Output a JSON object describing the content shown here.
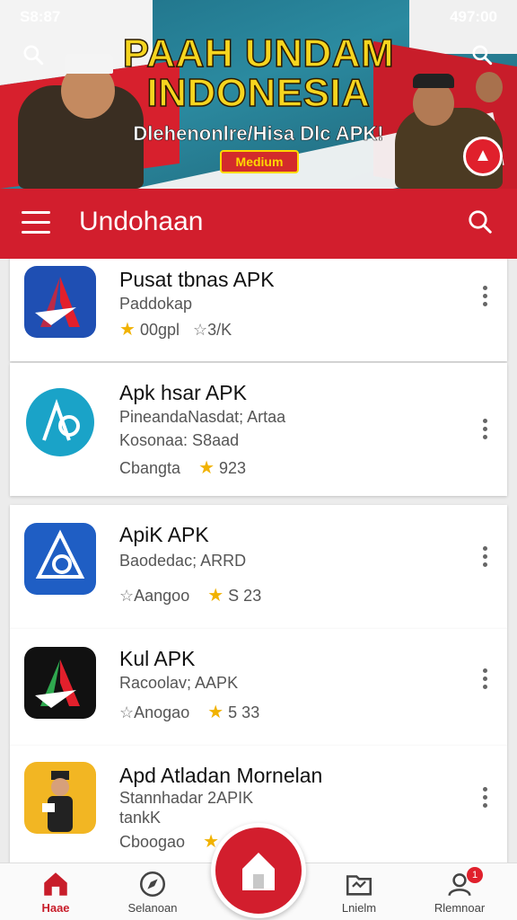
{
  "status_bar": {
    "left": "S8:87",
    "right": "497:00"
  },
  "banner": {
    "title_line1": "PAAH UNDAM",
    "title_line2": "INDONESIA",
    "subtitle": "Dlehenonlre/Hisa Dlc APK!",
    "badge": "Medium"
  },
  "appbar": {
    "title": "Undohaan"
  },
  "apps": [
    {
      "name": "Pusat tbnas APK",
      "line1": "Paddokap",
      "meta_left": "00gpl",
      "rating": "3/K"
    },
    {
      "name": "Apk hsar APK",
      "line1": "PineandaNasdat; Artaa",
      "line2": "Kosonaa: S8aad",
      "meta_left": "Cbangta",
      "rating": "923"
    },
    {
      "name": "ApiK APK",
      "line1": "Baodedac; ARRD",
      "meta_left": "Aangoo",
      "rating": "S 23"
    },
    {
      "name": "Kul APK",
      "line1": "Racoolav; AAPK",
      "meta_left": "Anogao",
      "rating": "5 33"
    },
    {
      "name": "Apd Atladan Mornelan",
      "line1": "Stannhadar 2APIK",
      "line2": "tankK",
      "meta_left": "Cboogao",
      "rating": ""
    }
  ],
  "bottom_nav": [
    {
      "label": "Haae"
    },
    {
      "label": "Selanoan"
    },
    {
      "label": "Lnielm"
    },
    {
      "label": "Rlemnoar",
      "badge": "1"
    }
  ],
  "colors": {
    "primary": "#d21e2d",
    "accent_star": "#f1b200",
    "background": "#ececec"
  }
}
